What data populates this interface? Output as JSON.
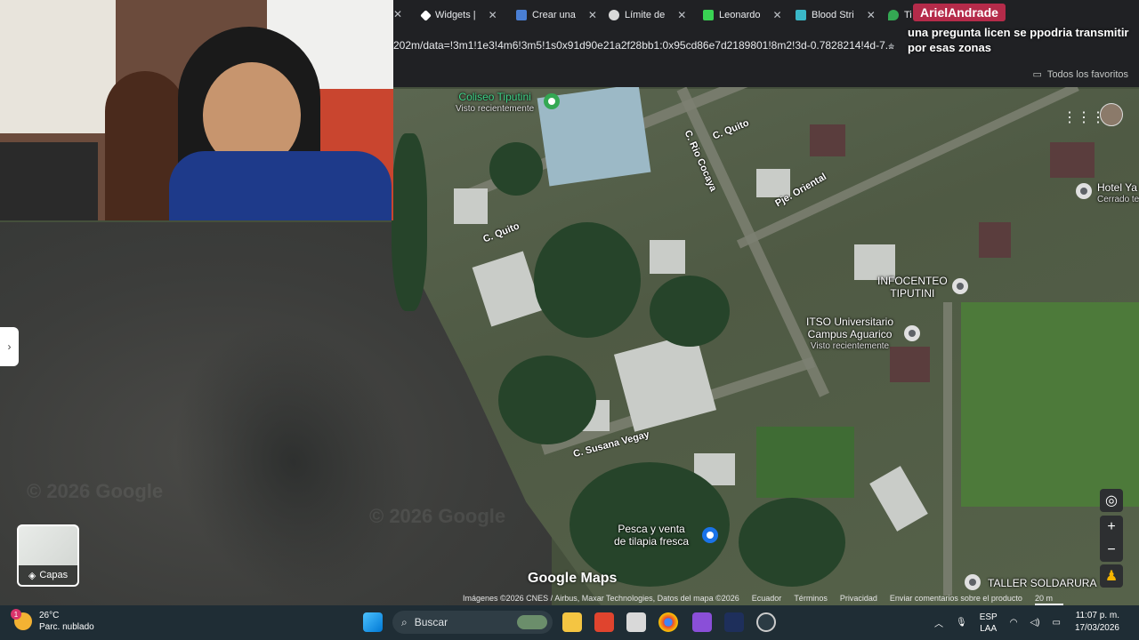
{
  "browser": {
    "tabs": [
      {
        "label": "Widgets |",
        "icon": "widgets-icon",
        "color": "#ffffff"
      },
      {
        "label": "Crear una",
        "icon": "paypal-icon",
        "color": "#4a7fd4"
      },
      {
        "label": "Límite de",
        "icon": "chatgpt-icon",
        "color": "#d9d9d9"
      },
      {
        "label": "Leonardo",
        "icon": "leonardo-icon",
        "color": "#39d353"
      },
      {
        "label": "Blood Stri",
        "icon": "blood-strike-icon",
        "color": "#3ab8c8"
      },
      {
        "label": "Ti",
        "icon": "google-maps-icon",
        "color": "#34a853"
      }
    ],
    "url": "202m/data=!3m1!1e3!4m6!3m5!1s0x91d90e21a2f28bb1:0x95cd86e7d2189801!8m2!3d-0.7828214!4d-7...",
    "bookmarks_label": "Todos los favoritos"
  },
  "chat": {
    "username": "ArielAndrade",
    "message": "una pregunta licen se ppodria transmitir por esas zonas"
  },
  "map": {
    "streets": [
      "C. Quito",
      "C. Rio Cocaya",
      "Pje. Oriental",
      "C. Quito",
      "C. Susana Vegay"
    ],
    "pois": {
      "coliseo": {
        "name": "Coliseo Tiputini",
        "sub": "Visto recientemente"
      },
      "infocentro": {
        "line1": "INFOCENTEO",
        "line2": "TIPUTINI"
      },
      "itso": {
        "line1": "ITSO Universitario",
        "line2": "Campus Aguarico",
        "sub": "Visto recientemente"
      },
      "hotel": {
        "line1": "Hotel Ya",
        "sub": "Cerrado te"
      },
      "pesca": {
        "line1": "Pesca y venta",
        "line2": "de tilapia fresca"
      },
      "taller": {
        "name": "TALLER SOLDARURA"
      }
    },
    "watermarks": [
      "© 2026 Google",
      "© 2026 Google"
    ],
    "layers_label": "Capas",
    "brand": "Google Maps",
    "attribution": {
      "imagery": "Imágenes ©2026 CNES / Airbus, Maxar Technologies, Datos del mapa ©2026",
      "country": "Ecuador",
      "terms": "Términos",
      "privacy": "Privacidad",
      "feedback": "Enviar comentarios sobre el producto",
      "scale": "20 m"
    }
  },
  "taskbar": {
    "weather_temp": "26°C",
    "weather_desc": "Parc. nublado",
    "weather_badge": "1",
    "search_placeholder": "Buscar",
    "lang1": "ESP",
    "lang2": "LAA",
    "time": "11:07 p. m.",
    "date": "17/03/2026"
  }
}
